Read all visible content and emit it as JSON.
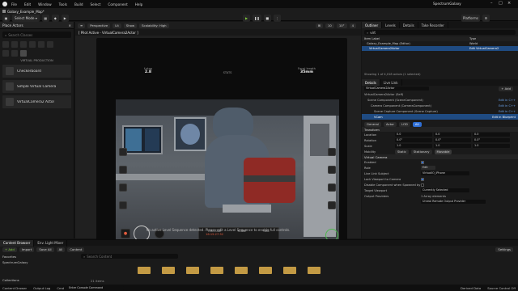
{
  "window": {
    "title": "SpectrumGalaxy",
    "tab": "Galaxy_Example_Map*"
  },
  "menu": [
    "File",
    "Edit",
    "Window",
    "Tools",
    "Build",
    "Select",
    "Component",
    "Help"
  ],
  "toolbar": {
    "select_mode": "Select Mode",
    "platforms": "Platforms"
  },
  "left_panel": {
    "title": "Place Actors",
    "search_placeholder": "Search Classes",
    "category": "VIRTUAL PRODUCTION",
    "items": [
      "Checkerboard",
      "Simple Virtual Camera",
      "VirtualCamera2 Actor"
    ]
  },
  "viewport": {
    "perspective": "Perspective",
    "lit": "Lit",
    "show": "Show",
    "scalability": "Scalability: High",
    "pilot_title": "[ Pilot Active - VirtualCamera2Actor ]",
    "hud": {
      "fstop_label": "f-stop",
      "fstop_value": "2.8",
      "stats_label": "STATS",
      "focal_label": "Focal length",
      "focal_value": "35mm"
    },
    "timecode_label": "TIMECODE",
    "timecode_value": "16:15:27:32",
    "scene_label": "SCENE",
    "take_label": "TAKE",
    "status": "No active Level Sequence detected. Please edit a Level Sequence to enable full controls."
  },
  "outliner": {
    "tabs": [
      "Outliner",
      "Levels",
      "Details",
      "Take Recorder"
    ],
    "search_value": "virt",
    "column_item": "Item Label",
    "column_type": "Type",
    "rows": [
      {
        "label": "Galaxy_Example_Map (Editor)",
        "type": "World"
      },
      {
        "label": "VirtualCamera2Actor",
        "type": "Edit VirtualCamera2"
      }
    ],
    "count": "Showing 1 of 4,018 actors (1 selected)"
  },
  "details": {
    "tabs": [
      "Details",
      "Live Link"
    ],
    "actor_name": "VirtualCamera2Actor",
    "add_label": "+ Add",
    "components": [
      "VirtualCamera2Actor (Self)",
      "Scene Component (SceneComponent)",
      "Camera Component (CameraComponent)",
      "Scene Capture Component (Scene Capture)",
      "VCam"
    ],
    "edit_links": [
      "Edit in C++",
      "Edit in C++",
      "Edit in C++",
      "Edit in Blueprint"
    ],
    "filter_tabs": [
      "General",
      "Actor",
      "LOD",
      "All"
    ],
    "transform": {
      "section": "Transform",
      "location_label": "Location",
      "location": [
        "0.0",
        "0.0",
        "0.0"
      ],
      "rotation_label": "Rotation",
      "rotation": [
        "0.0°",
        "0.0°",
        "0.0°"
      ],
      "scale_label": "Scale",
      "scale": [
        "1.0",
        "1.0",
        "1.0"
      ],
      "mobility_label": "Mobility",
      "mobility": [
        "Static",
        "Stationary",
        "Movable"
      ]
    },
    "vcam": {
      "section": "Virtual Camera",
      "enabled_label": "Enabled",
      "role_label": "Role",
      "role_value": "Edit",
      "live_link_label": "Live Link Subject",
      "live_link_value": "VirtualIO_iPhone",
      "lock_viewport_label": "Lock Viewport to Camera",
      "disable_label": "Disable Component when Spawned by Seq...",
      "target_label": "Target Viewport",
      "target_value": "Currently Selected",
      "output_label": "Output Providers",
      "output_count": "1 Array elements",
      "output_value": "Unreal Remote Output Provider"
    }
  },
  "content_browser": {
    "tabs": [
      "Content Browser",
      "Env. Light Mixer"
    ],
    "add": "+ Add",
    "import": "Import",
    "save_all": "Save All",
    "all_label": "All",
    "path": "Content",
    "search_placeholder": "Search Content",
    "settings": "Settings",
    "favorites": "Favorites",
    "project": "SpectrumGalaxy",
    "items_count": "21 items",
    "collections": "Collections",
    "folder_count": 8
  },
  "status_bar": {
    "items": [
      "Content Drawer",
      "Output Log",
      "Cmd"
    ],
    "cmd_placeholder": "Enter Console Command",
    "right": [
      "Derived Data",
      "Source Control Off"
    ]
  }
}
